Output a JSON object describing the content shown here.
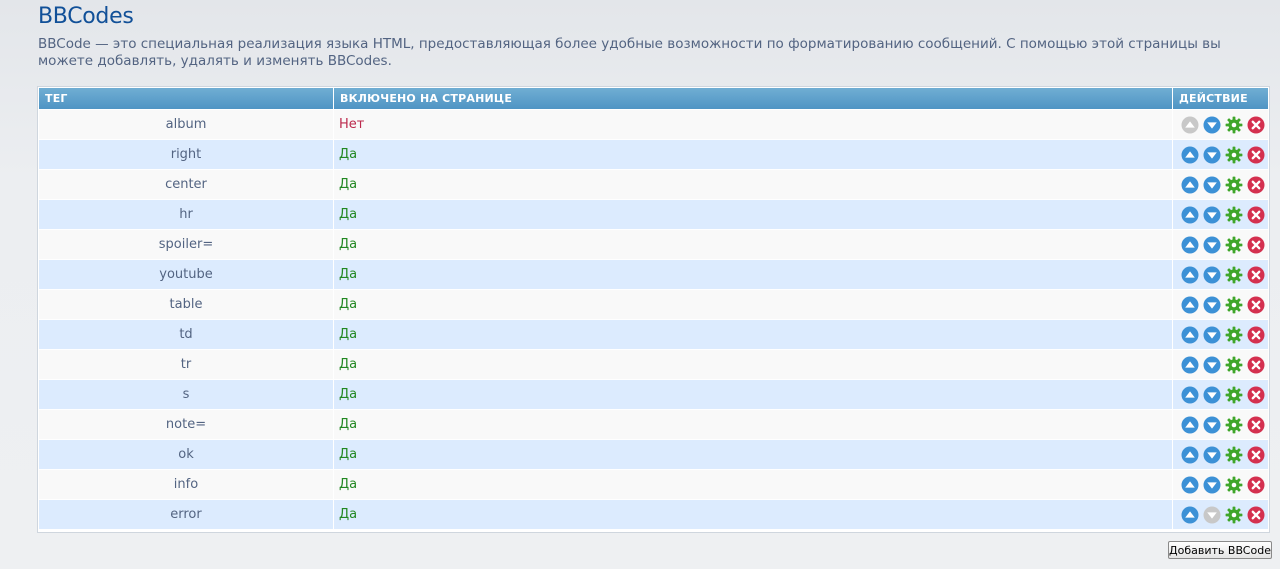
{
  "page": {
    "title": "BBCodes",
    "description": "BBCode — это специальная реализация языка HTML, предоставляющая более удобные возможности по форматированию сообщений. С помощью этой страницы вы можете добавлять, удалять и изменять BBCodes."
  },
  "table": {
    "headers": {
      "tag": "ТЕГ",
      "shown_on_posting": "ВКЛЮЧЕНО НА СТРАНИЦЕ",
      "action": "ДЕЙСТВИЕ"
    },
    "rows": [
      {
        "tag": "album",
        "shown": "Нет",
        "shown_state": "no",
        "up_enabled": false,
        "down_enabled": true
      },
      {
        "tag": "right",
        "shown": "Да",
        "shown_state": "yes",
        "up_enabled": true,
        "down_enabled": true
      },
      {
        "tag": "center",
        "shown": "Да",
        "shown_state": "yes",
        "up_enabled": true,
        "down_enabled": true
      },
      {
        "tag": "hr",
        "shown": "Да",
        "shown_state": "yes",
        "up_enabled": true,
        "down_enabled": true
      },
      {
        "tag": "spoiler=",
        "shown": "Да",
        "shown_state": "yes",
        "up_enabled": true,
        "down_enabled": true
      },
      {
        "tag": "youtube",
        "shown": "Да",
        "shown_state": "yes",
        "up_enabled": true,
        "down_enabled": true
      },
      {
        "tag": "table",
        "shown": "Да",
        "shown_state": "yes",
        "up_enabled": true,
        "down_enabled": true
      },
      {
        "tag": "td",
        "shown": "Да",
        "shown_state": "yes",
        "up_enabled": true,
        "down_enabled": true
      },
      {
        "tag": "tr",
        "shown": "Да",
        "shown_state": "yes",
        "up_enabled": true,
        "down_enabled": true
      },
      {
        "tag": "s",
        "shown": "Да",
        "shown_state": "yes",
        "up_enabled": true,
        "down_enabled": true
      },
      {
        "tag": "note=",
        "shown": "Да",
        "shown_state": "yes",
        "up_enabled": true,
        "down_enabled": true
      },
      {
        "tag": "ok",
        "shown": "Да",
        "shown_state": "yes",
        "up_enabled": true,
        "down_enabled": true
      },
      {
        "tag": "info",
        "shown": "Да",
        "shown_state": "yes",
        "up_enabled": true,
        "down_enabled": true
      },
      {
        "tag": "error",
        "shown": "Да",
        "shown_state": "yes",
        "up_enabled": true,
        "down_enabled": false
      }
    ]
  },
  "actions": {
    "add_button_label": "Добавить BBCode",
    "icons": {
      "move_up": "arrow-up-icon",
      "move_down": "arrow-down-icon",
      "edit": "gear-icon",
      "delete": "delete-icon"
    }
  },
  "colors": {
    "title": "#115098",
    "text": "#536482",
    "header_bg": "#5fa0cc",
    "row_alt_bg": "#dcebfe",
    "status_yes": "#228822",
    "status_no": "#bc2a4d",
    "icon_blue": "#3c91d6",
    "icon_disabled": "#c8c8c8",
    "icon_green": "#3fa62a",
    "icon_red": "#d4304f"
  }
}
